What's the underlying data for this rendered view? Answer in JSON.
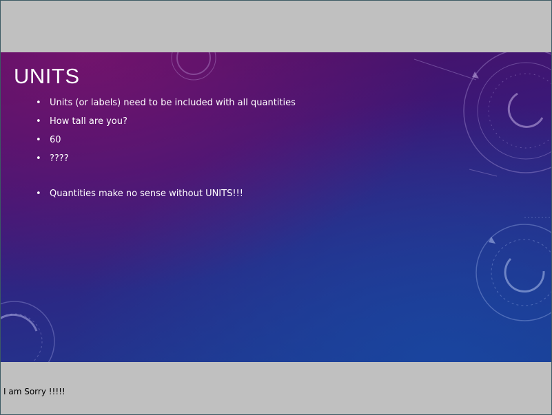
{
  "slide": {
    "title": "UNITS",
    "bullets": [
      "Units (or labels) need to be included with all quantities",
      "How tall are you?",
      "60",
      "????",
      "Quantities make no sense without UNITS!!!"
    ]
  },
  "footer_note": "I am Sorry !!!!!",
  "colors": {
    "page_background": "#c0c0c0",
    "slide_gradient_start": "#4e0f63",
    "slide_gradient_end": "#1c3c92",
    "slide_text": "#ffffff"
  },
  "decorations": [
    "circular-hud-graphic",
    "circular-hud-graphic",
    "circular-hud-graphic",
    "circular-hud-graphic"
  ]
}
